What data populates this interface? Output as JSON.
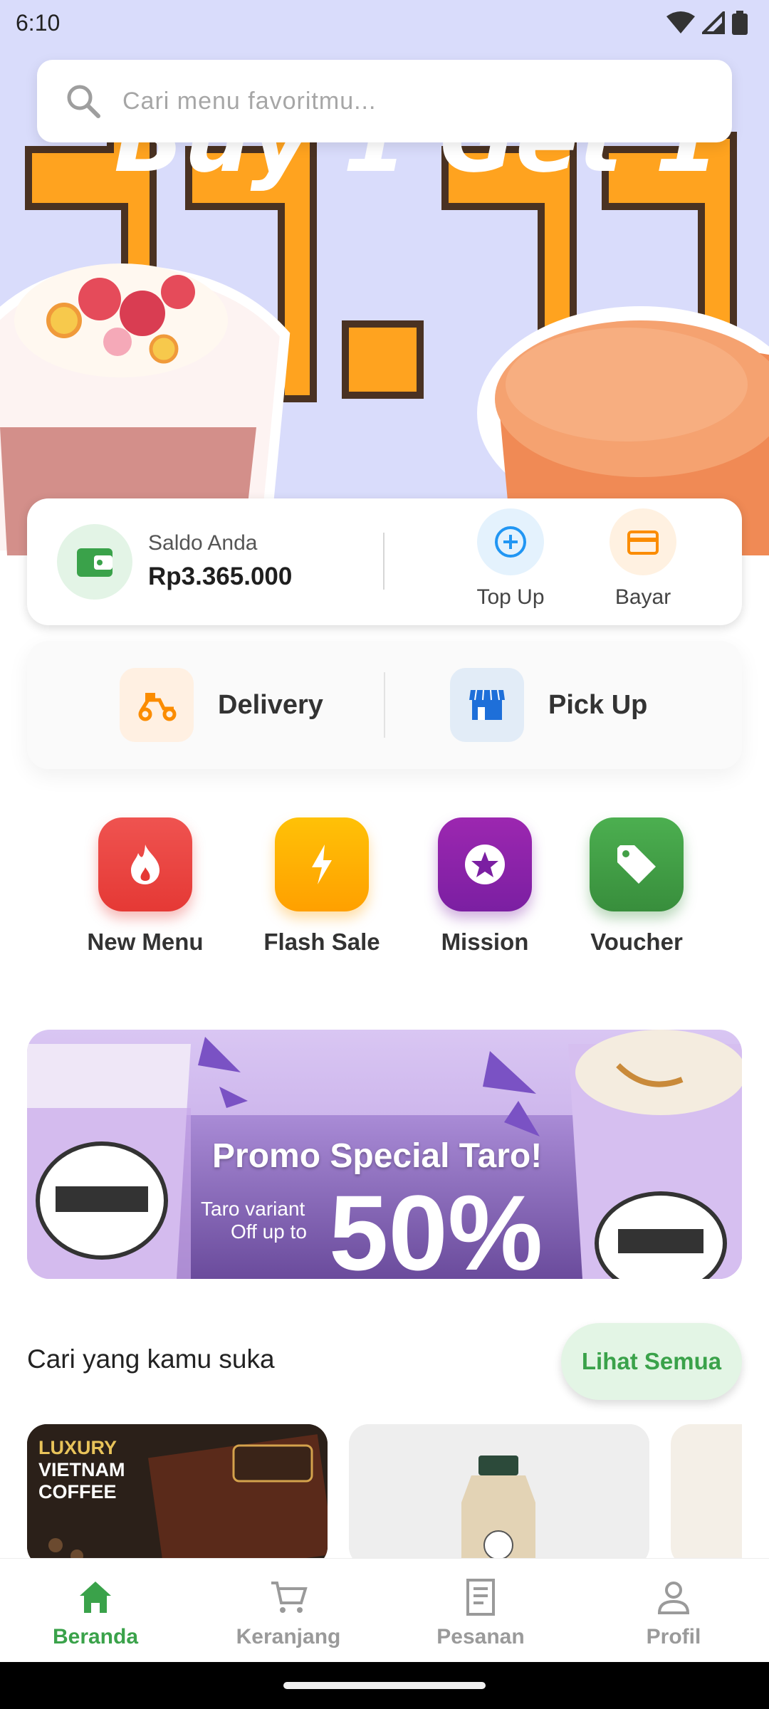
{
  "status_bar": {
    "time": "6:10"
  },
  "search": {
    "placeholder": "Cari menu favoritmu..."
  },
  "wallet": {
    "label": "Saldo Anda",
    "amount": "Rp3.365.000",
    "topup_label": "Top Up",
    "pay_label": "Bayar"
  },
  "services": {
    "delivery_label": "Delivery",
    "pickup_label": "Pick Up"
  },
  "categories": [
    {
      "label": "New Menu",
      "color": "#e53935",
      "icon": "fire-icon"
    },
    {
      "label": "Flash Sale",
      "color": "#ffa726",
      "icon": "flash-icon"
    },
    {
      "label": "Mission",
      "color": "#8e24aa",
      "icon": "star-badge-icon"
    },
    {
      "label": "Voucher",
      "color": "#43a047",
      "icon": "tag-icon"
    }
  ],
  "promo": {
    "title": "Promo Special Taro!",
    "sub1": "Taro variant",
    "sub2": "Off up to",
    "big": "50%"
  },
  "section": {
    "title": "Cari yang kamu suka",
    "see_all": "Lihat Semua"
  },
  "products": [
    {
      "caption_line1": "LUXURY",
      "caption_line2": "VIETNAM",
      "caption_line3": "COFFEE"
    }
  ],
  "bottom_nav": [
    {
      "label": "Beranda",
      "icon": "home-icon",
      "active": true
    },
    {
      "label": "Keranjang",
      "icon": "cart-icon"
    },
    {
      "label": "Pesanan",
      "icon": "receipt-icon"
    },
    {
      "label": "Profil",
      "icon": "profile-icon"
    }
  ],
  "colors": {
    "accent": "#3aa24a",
    "hero_bg": "#d9dcfb",
    "topup": "#2196f3",
    "bayar": "#fb8c00"
  }
}
